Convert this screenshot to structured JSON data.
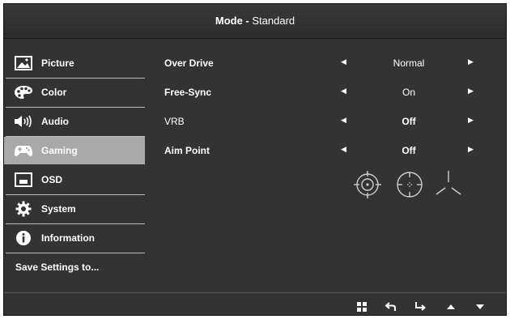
{
  "header": {
    "title_prefix": "Mode -",
    "title_mode": " Standard"
  },
  "sidebar": {
    "items": [
      {
        "label": "Picture",
        "icon": "picture-icon",
        "active": false
      },
      {
        "label": "Color",
        "icon": "palette-icon",
        "active": false
      },
      {
        "label": "Audio",
        "icon": "speaker-icon",
        "active": false
      },
      {
        "label": "Gaming",
        "icon": "gamepad-icon",
        "active": true
      },
      {
        "label": "OSD",
        "icon": "osd-icon",
        "active": false
      },
      {
        "label": "System",
        "icon": "gear-icon",
        "active": false
      },
      {
        "label": "Information",
        "icon": "info-icon",
        "active": false
      }
    ],
    "save_label": "Save Settings to..."
  },
  "settings": {
    "rows": [
      {
        "label": "Over Drive",
        "value": "Normal"
      },
      {
        "label": "Free-Sync",
        "value": "On"
      },
      {
        "label": "VRB",
        "value": "Off"
      },
      {
        "label": "Aim Point",
        "value": "Off"
      }
    ],
    "aim_icons": [
      "aim-point-1-icon",
      "aim-point-2-icon",
      "aim-point-3-icon"
    ]
  },
  "footer": {
    "buttons": [
      "menu-icon",
      "back-icon",
      "enter-icon",
      "up-icon",
      "down-icon"
    ]
  },
  "colors": {
    "background": "#333333",
    "active_item": "#a9a9a9",
    "text": "#ffffff"
  }
}
